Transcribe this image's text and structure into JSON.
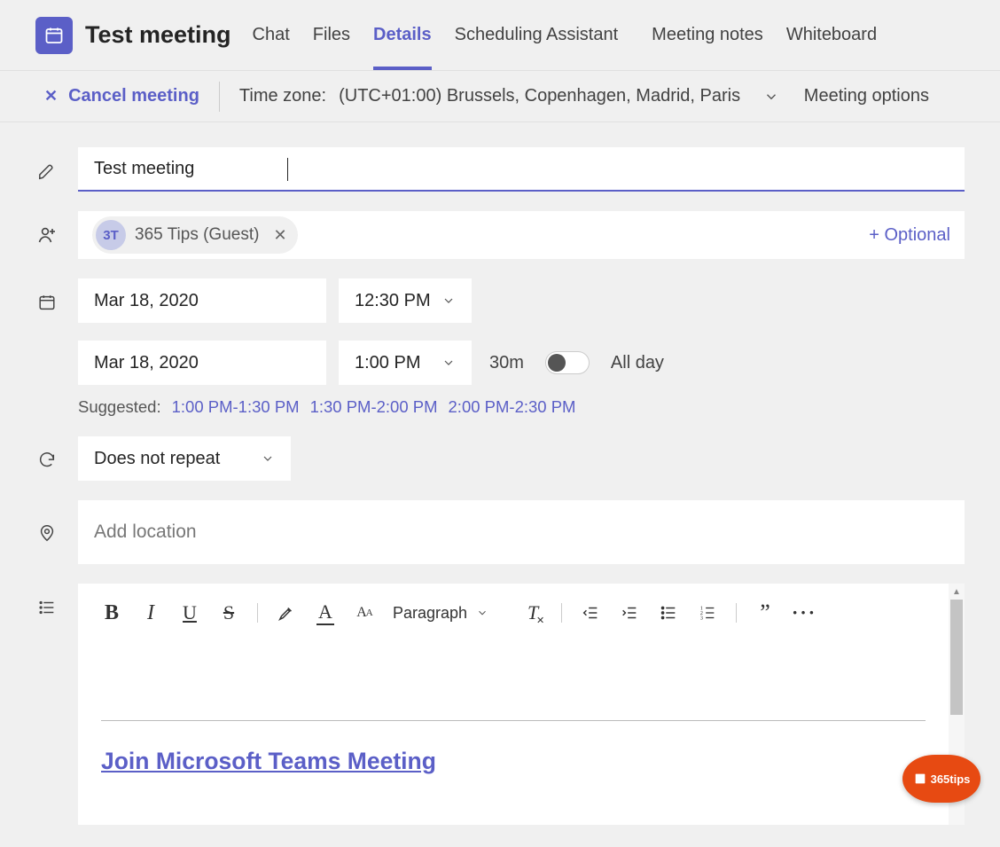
{
  "colors": {
    "accent": "#5b5fc7",
    "brand": "#e74a12"
  },
  "header": {
    "title": "Test meeting",
    "tabs": [
      {
        "id": "chat",
        "label": "Chat"
      },
      {
        "id": "files",
        "label": "Files"
      },
      {
        "id": "details",
        "label": "Details",
        "active": true
      },
      {
        "id": "scheduling",
        "label": "Scheduling Assistant"
      },
      {
        "id": "notes",
        "label": "Meeting notes"
      },
      {
        "id": "whiteboard",
        "label": "Whiteboard"
      }
    ]
  },
  "actionbar": {
    "cancel": "Cancel meeting",
    "timezone_label": "Time zone:",
    "timezone_value": "(UTC+01:00) Brussels, Copenhagen, Madrid, Paris",
    "meeting_options": "Meeting options"
  },
  "form": {
    "title": "Test meeting",
    "attendees": {
      "items": [
        {
          "initials": "3T",
          "name": "365 Tips (Guest)"
        }
      ],
      "add_optional": "+ Optional"
    },
    "start": {
      "date": "Mar 18, 2020",
      "time": "12:30 PM"
    },
    "end": {
      "date": "Mar 18, 2020",
      "time": "1:00 PM"
    },
    "duration": "30m",
    "all_day": {
      "label": "All day",
      "value": false
    },
    "suggested": {
      "label": "Suggested:",
      "slots": [
        "1:00 PM-1:30 PM",
        "1:30 PM-2:00 PM",
        "2:00 PM-2:30 PM"
      ]
    },
    "repeat": "Does not repeat",
    "location_placeholder": "Add location",
    "editor": {
      "paragraph_label": "Paragraph",
      "join_link": "Join Microsoft Teams Meeting"
    }
  },
  "badge": {
    "text": "365tips"
  }
}
